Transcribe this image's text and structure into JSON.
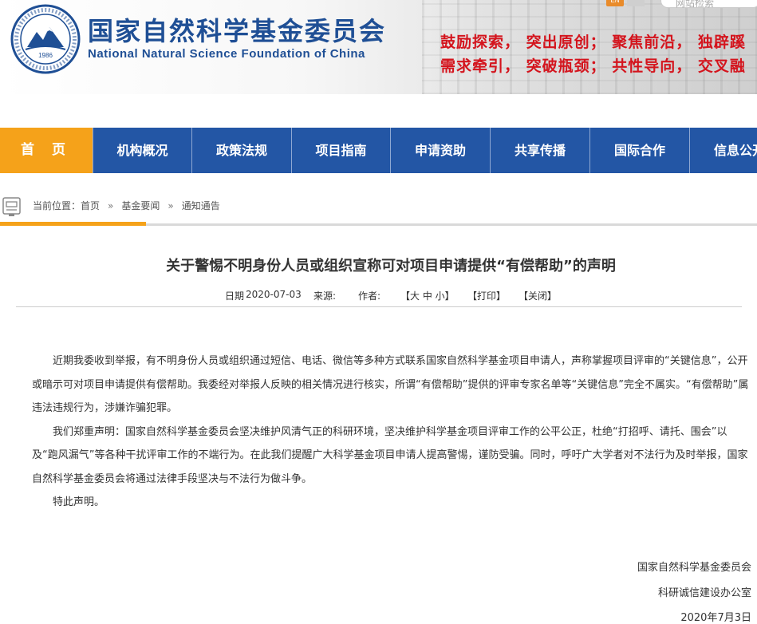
{
  "header": {
    "logo_year": "1986",
    "title_zh": "国家自然科学基金委员会",
    "title_en": "National Natural Science Foundation of China",
    "slogan_line1": "鼓励探索， 突出原创； 聚焦前沿， 独辟蹊",
    "slogan_line2": "需求牵引， 突破瓶颈； 共性导向， 交叉融",
    "lang_label": "EN",
    "search_placeholder": "网站检索",
    "colors": {
      "brand_blue": "#1f4f95",
      "slogan_red": "#d4141d"
    }
  },
  "nav": {
    "items": [
      {
        "label": "首 页",
        "active": true
      },
      {
        "label": "机构概况"
      },
      {
        "label": "政策法规"
      },
      {
        "label": "项目指南"
      },
      {
        "label": "申请资助"
      },
      {
        "label": "共享传播"
      },
      {
        "label": "国际合作"
      },
      {
        "label": "信息公开"
      }
    ],
    "colors": {
      "bar": "#2356a5",
      "active": "#f5a21a"
    }
  },
  "breadcrumb": {
    "prefix": "当前位置：",
    "items": [
      "首页",
      "基金要闻",
      "通知通告"
    ],
    "separator": "»"
  },
  "article": {
    "title": "关于警惕不明身份人员或组织宣称可对项目申请提供“有偿帮助”的声明",
    "meta": {
      "date_label": "日期",
      "date": "2020-07-03",
      "source_label": "来源:",
      "author_label": "作者:",
      "font_size_label": "【大 中 小】",
      "print_label": "【打印】",
      "close_label": "【关闭】"
    },
    "paragraphs": [
      "近期我委收到举报，有不明身份人员或组织通过短信、电话、微信等多种方式联系国家自然科学基金项目申请人，声称掌握项目评审的“关键信息”，公开或暗示可对项目申请提供有偿帮助。我委经对举报人反映的相关情况进行核实，所谓“有偿帮助”提供的评审专家名单等“关键信息”完全不属实。“有偿帮助”属违法违规行为，涉嫌诈骗犯罪。",
      "我们郑重声明：国家自然科学基金委员会坚决维护风清气正的科研环境，坚决维护科学基金项目评审工作的公平公正，杜绝“打招呼、请托、围会”以及“跑风漏气”等各种干扰评审工作的不端行为。在此我们提醒广大科学基金项目申请人提高警惕，谨防受骗。同时，呼吁广大学者对不法行为及时举报，国家自然科学基金委员会将通过法律手段坚决与不法行为做斗争。",
      "特此声明。"
    ],
    "signature": {
      "org": "国家自然科学基金委员会",
      "office": "科研诚信建设办公室",
      "date": "2020年7月3日"
    }
  }
}
